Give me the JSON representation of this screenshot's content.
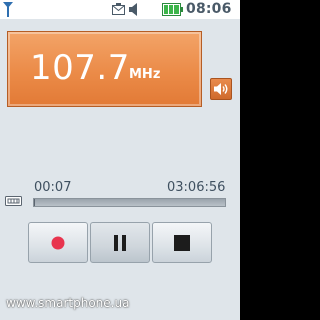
{
  "status_bar": {
    "time": "08:06",
    "icons": [
      "signal-icon",
      "message-icon",
      "volume-icon",
      "battery-icon"
    ]
  },
  "radio": {
    "frequency": "107.7",
    "unit": "MHz",
    "speaker_icon": "speaker-icon"
  },
  "playback": {
    "elapsed": "00:07",
    "total": "03:06:56",
    "progress": 0.0006
  },
  "controls": {
    "record_icon": "record-icon",
    "pause_icon": "pause-icon",
    "stop_icon": "stop-icon",
    "record_color": "#e8344e"
  },
  "watermark": "www.smartphone.ua",
  "colors": {
    "accent_orange": "#eb8b48",
    "background": "#dfe5ea",
    "text_dark": "#3f5060"
  }
}
